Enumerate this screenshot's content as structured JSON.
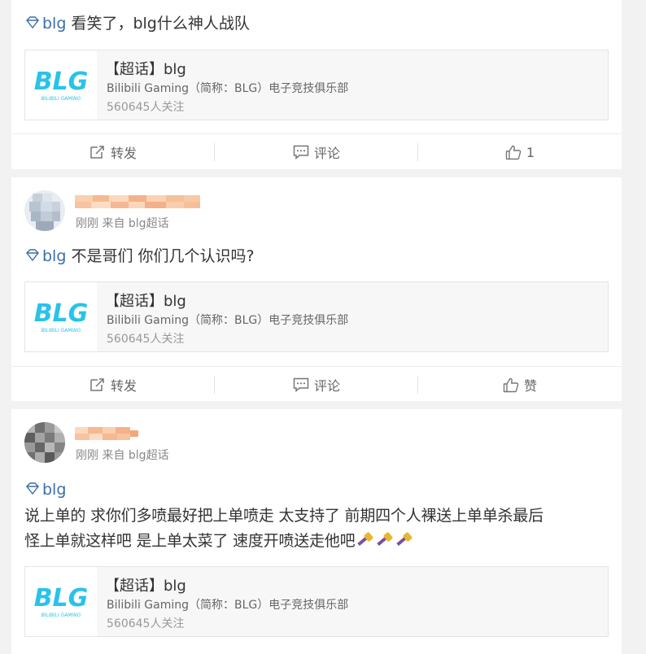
{
  "posts": [
    {
      "body": "看笑了，blg什么神人战队",
      "topic": "blg",
      "card": {
        "title": "【超话】blg",
        "desc": "Bilibili Gaming（简称：BLG）电子竞技俱乐部",
        "follow": "560645人关注",
        "logo_text": "BLG",
        "logo_sub": "BILIBILI GAMING"
      },
      "actions": {
        "repost": "转发",
        "comment": "评论",
        "like": "1"
      }
    },
    {
      "meta": "刚刚 来自 blg超话",
      "topic": "blg",
      "body": "不是哥们 你们几个认识吗?",
      "card": {
        "title": "【超话】blg",
        "desc": "Bilibili Gaming（简称：BLG）电子竞技俱乐部",
        "follow": "560645人关注",
        "logo_text": "BLG",
        "logo_sub": "BILIBILI GAMING"
      },
      "actions": {
        "repost": "转发",
        "comment": "评论",
        "like": "赞"
      }
    },
    {
      "meta": "刚刚 来自 blg超话",
      "topic": "blg",
      "body_line1": "说上单的 求你们多喷最好把上单喷走 太支持了 前期四个人裸送上单单杀最后",
      "body_line2": "怪上单就这样吧 是上单太菜了 速度开喷送走他吧",
      "card": {
        "title": "【超话】blg",
        "desc": "Bilibili Gaming（简称：BLG）电子竞技俱乐部",
        "follow": "560645人关注",
        "logo_text": "BLG",
        "logo_sub": "BILIBILI GAMING"
      }
    }
  ],
  "colors": {
    "topic": "#3a6ea8",
    "logo": "#29c3ea",
    "username_blur": "#f6b98f"
  },
  "icons": [
    "diamond-icon",
    "repost-icon",
    "comment-icon",
    "like-icon",
    "hammer-emoji-icon"
  ]
}
